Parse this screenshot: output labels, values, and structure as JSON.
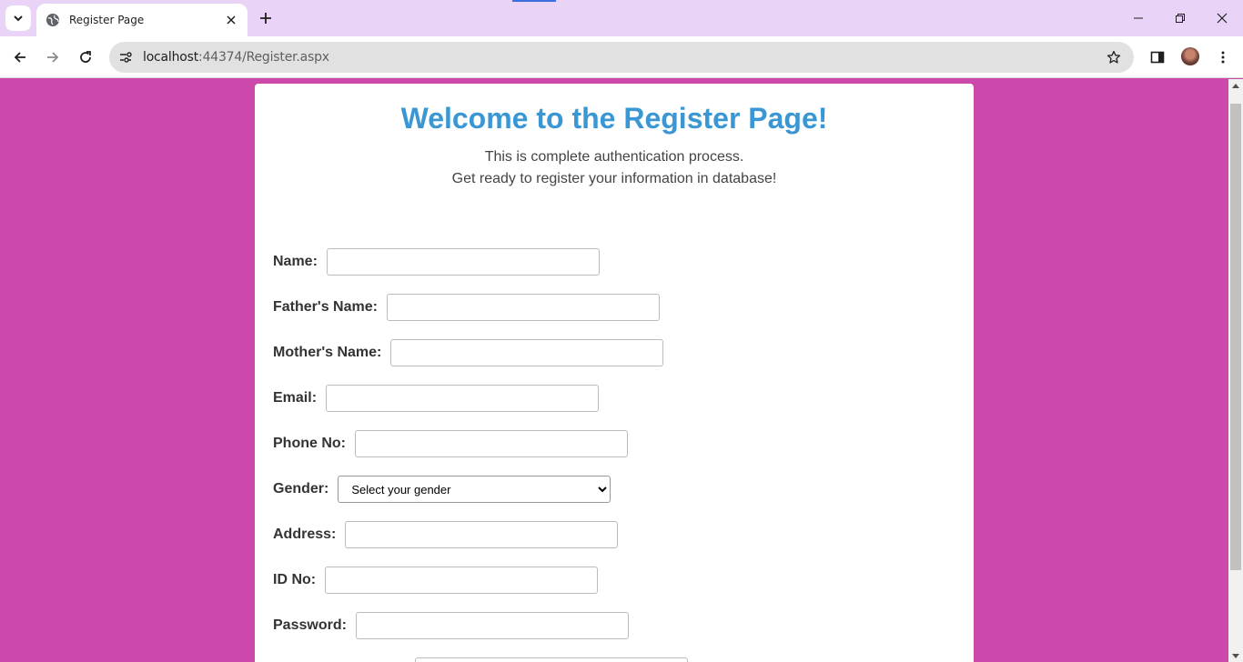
{
  "browser": {
    "tab_title": "Register Page",
    "url_host": "localhost",
    "url_path": ":44374/Register.aspx"
  },
  "page": {
    "heading": "Welcome to the Register Page!",
    "subtitle_line1": "This is complete authentication process.",
    "subtitle_line2": "Get ready to register your information in database!",
    "background_color": "#cc48aa",
    "heading_color": "#3a97d4"
  },
  "form": {
    "name_label": "Name:",
    "name_value": "",
    "father_label": "Father's Name:",
    "father_value": "",
    "mother_label": "Mother's Name:",
    "mother_value": "",
    "email_label": "Email:",
    "email_value": "",
    "phone_label": "Phone No:",
    "phone_value": "",
    "gender_label": "Gender:",
    "gender_selected": "Select your gender",
    "address_label": "Address:",
    "address_value": "",
    "id_label": "ID No:",
    "id_value": "",
    "password_label": "Password:",
    "password_value": ""
  }
}
